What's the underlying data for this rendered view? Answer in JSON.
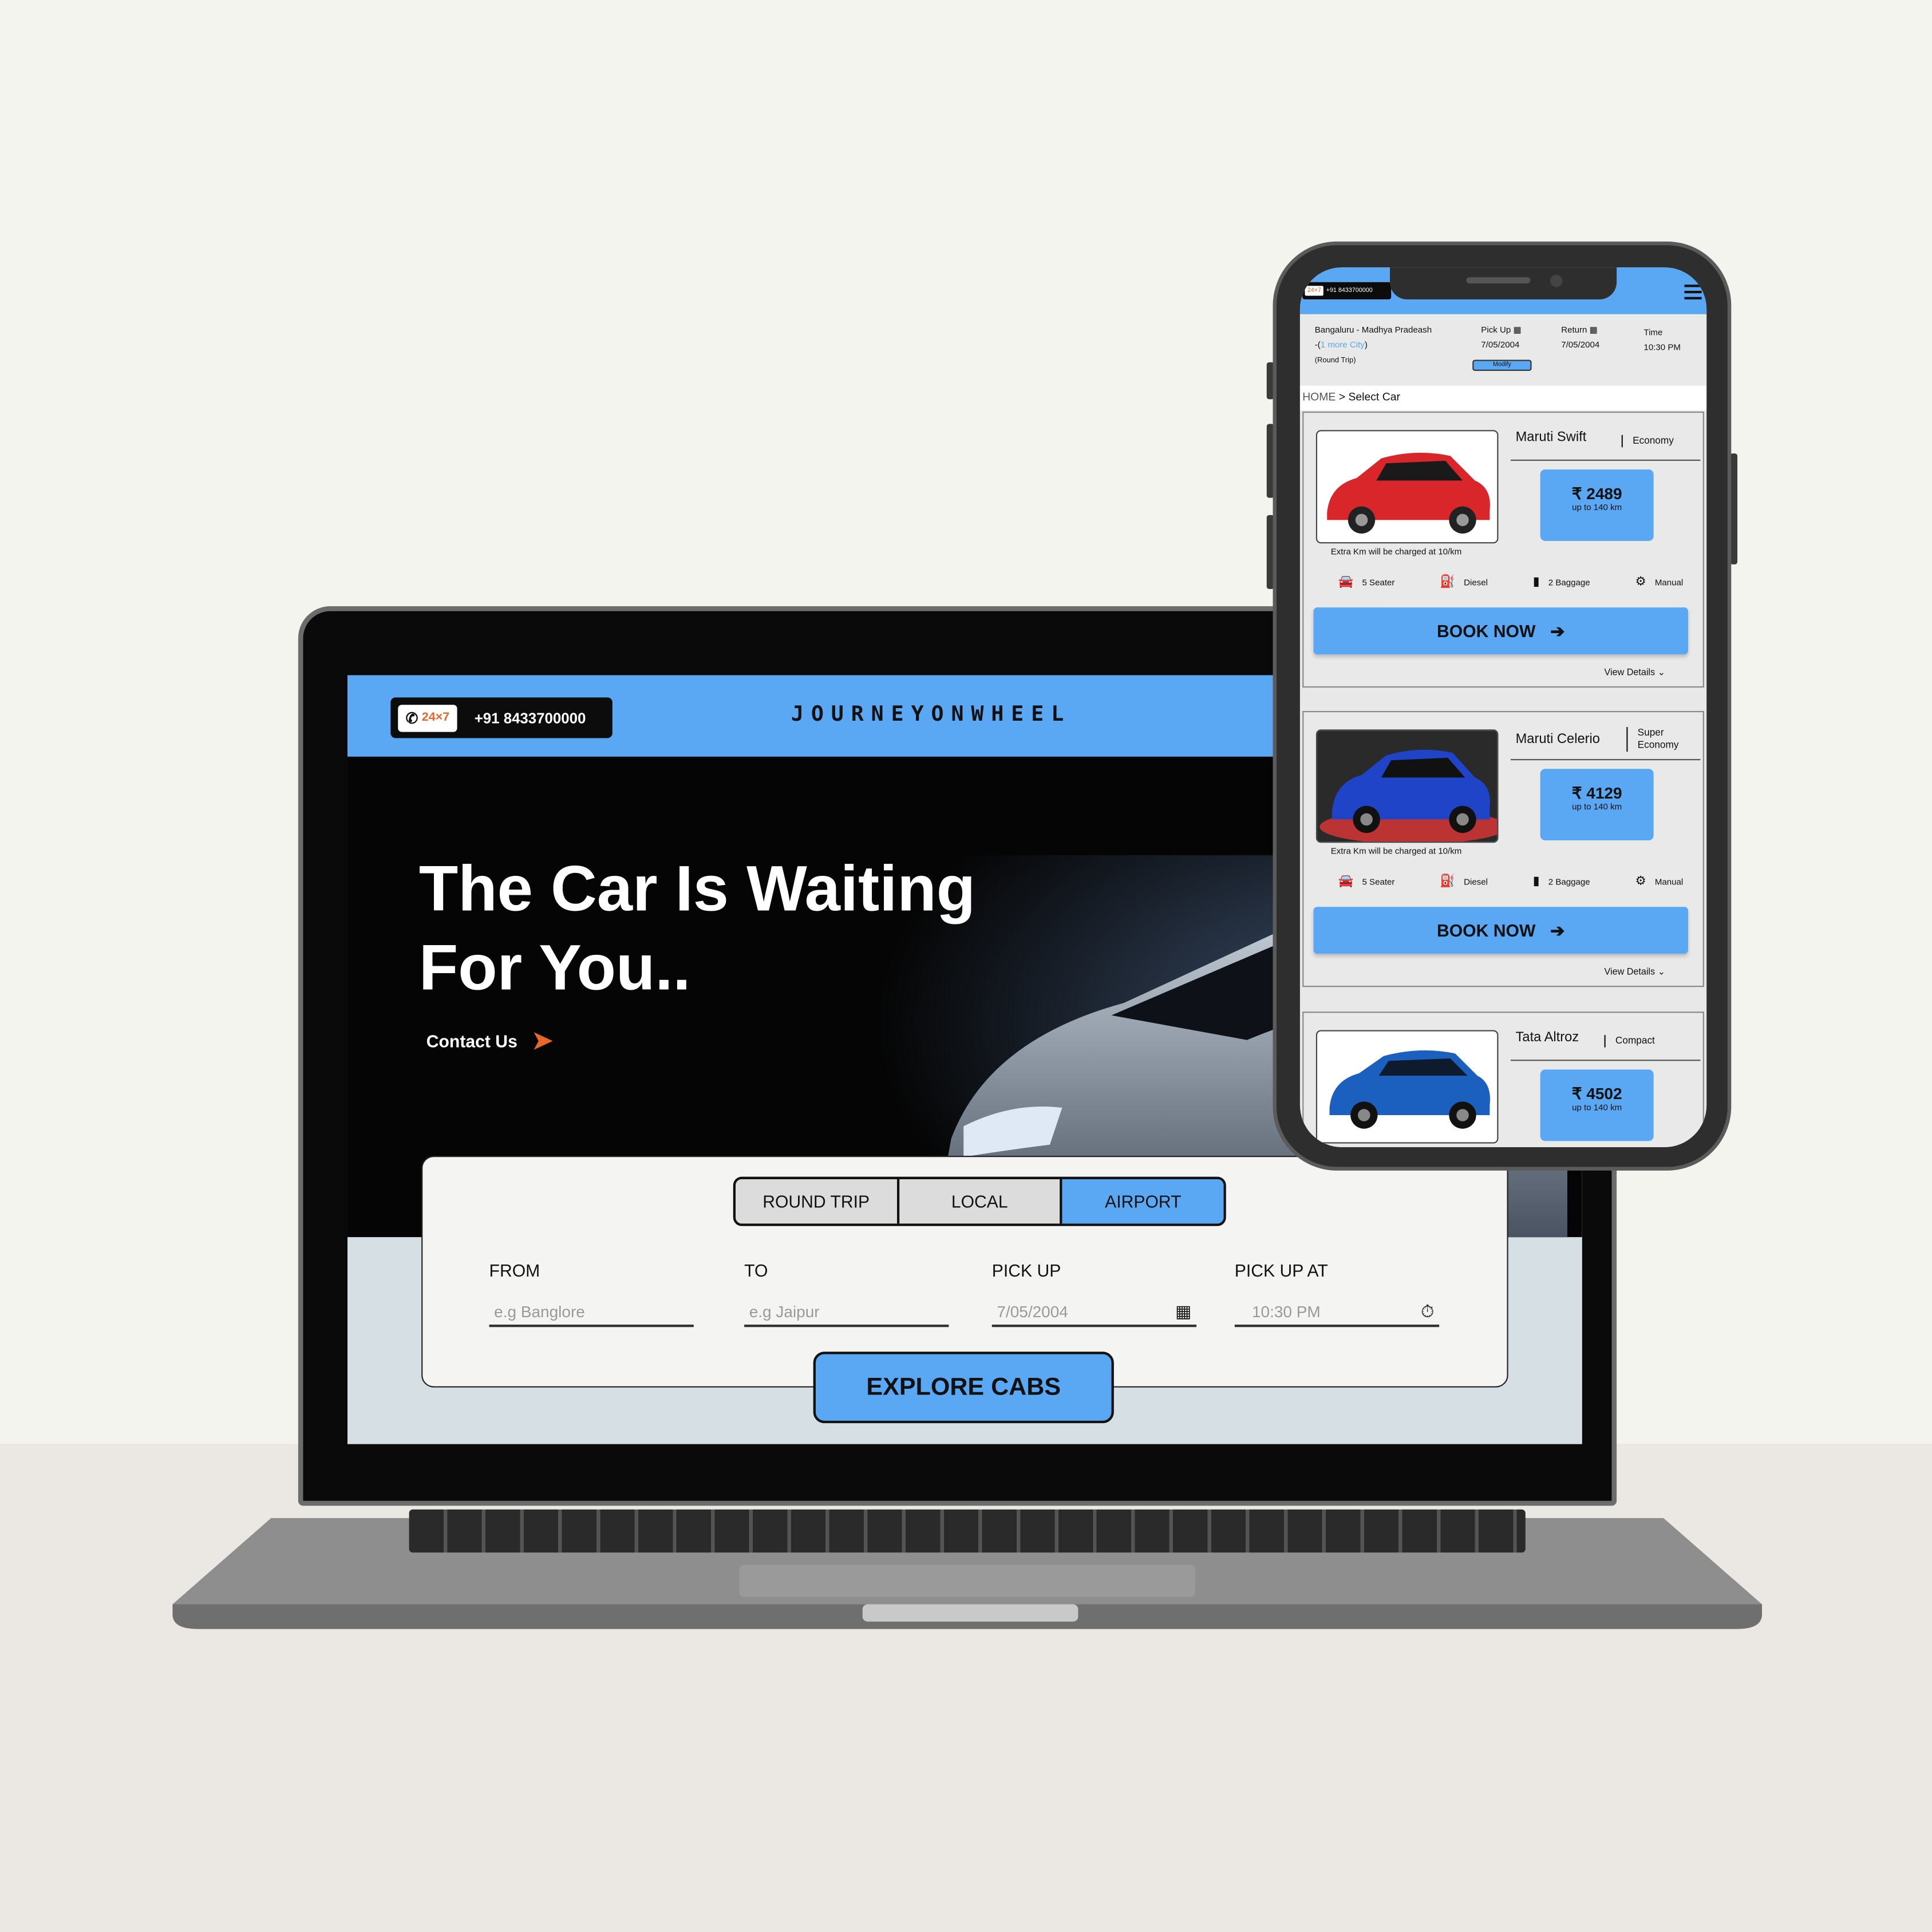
{
  "laptop": {
    "support_badge": "24×7",
    "phone": "+91 8433700000",
    "brand": "JOURNEYONWHEEL",
    "headline_line1": "The Car Is Waiting",
    "headline_line2": "For You..",
    "contact_label": "Contact Us",
    "tabs": [
      "ROUND TRIP",
      "LOCAL",
      "AIRPORT"
    ],
    "active_tab": "AIRPORT",
    "fields": [
      {
        "label": "FROM",
        "placeholder": "e.g Banglore",
        "icon": ""
      },
      {
        "label": "TO",
        "placeholder": "e.g Jaipur",
        "icon": ""
      },
      {
        "label": "PICK UP",
        "placeholder": "7/05/2004",
        "icon": "calendar-icon"
      },
      {
        "label": "PICK UP AT",
        "placeholder": "10:30 PM",
        "icon": "stopwatch-icon"
      }
    ],
    "explore_label": "EXPLORE CABS"
  },
  "phone": {
    "support_badge": "24×7",
    "phone": "+91 8433700000",
    "route": "Bangaluru - Madhya Pradeash",
    "route_prefix": "-(",
    "route_more": "1 more City",
    "route_suffix": ")",
    "trip_type": "(Round Trip)",
    "pickup_label": "Pick Up",
    "pickup_date": "7/05/2004",
    "return_label": "Return",
    "return_date": "7/05/2004",
    "time_label": "Time",
    "time_value": "10:30 PM",
    "modify_label": "Modify",
    "crumb_home": "HOME",
    "crumb_sep": ">",
    "crumb_page": "Select Car",
    "cars": [
      {
        "name": "Maruti Swift",
        "category": "Economy",
        "price": "₹ 2489",
        "limit": "up to 140 km",
        "extra": "Extra Km will be charged at 10/km",
        "seats": "5 Seater",
        "fuel": "Diesel",
        "baggage": "2 Baggage",
        "trans": "Manual",
        "book": "BOOK NOW",
        "details": "View Details",
        "color": "#d8262a"
      },
      {
        "name": "Maruti Celerio",
        "category": "Super Economy",
        "price": "₹ 4129",
        "limit": "up to 140 km",
        "extra": "Extra Km will be charged at 10/km",
        "seats": "5 Seater",
        "fuel": "Diesel",
        "baggage": "2 Baggage",
        "trans": "Manual",
        "book": "BOOK NOW",
        "details": "View Details",
        "color": "#1f44c8"
      },
      {
        "name": "Tata Altroz",
        "category": "Compact",
        "price": "₹ 4502",
        "limit": "up to 140 km",
        "color": "#1b5fbf"
      }
    ]
  }
}
